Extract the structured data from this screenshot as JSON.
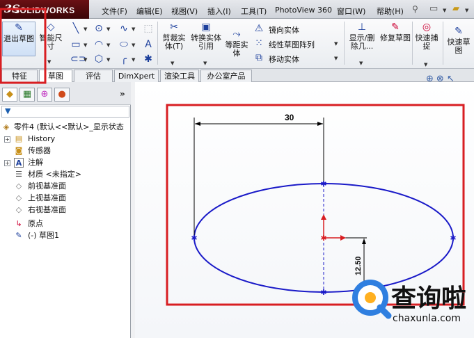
{
  "app": {
    "name": "SOLIDWORKS",
    "logo_mark": "3S"
  },
  "menu": {
    "items": [
      "文件(F)",
      "编辑(E)",
      "视图(V)",
      "插入(I)",
      "工具(T)",
      "PhotoView 360",
      "窗口(W)",
      "帮助(H)"
    ]
  },
  "ribbon": {
    "exit_sketch": "退出草图",
    "smart_dim": "智能尺寸",
    "trim": "剪裁实体(T)",
    "convert": "转换实体引用",
    "offset": "等距实体",
    "mirror": "镜向实体",
    "linear_pattern": "线性草图阵列",
    "move": "移动实体",
    "display_delete": "显示/删除几...",
    "repair": "修复草图",
    "quick_snap": "快速捕捉",
    "rapid_sketch": "快速草图"
  },
  "tabs": [
    "特征",
    "草图",
    "评估",
    "DimXpert",
    "渲染工具",
    "办公室产品"
  ],
  "tree": {
    "root": "零件4 (默认<<默认>_显示状态",
    "items": [
      "History",
      "传感器",
      "注解",
      "材质 <未指定>",
      "前视基准面",
      "上视基准面",
      "右视基准面",
      "原点",
      "(-) 草图1"
    ]
  },
  "drawing": {
    "dim_horizontal": "30",
    "dim_vertical": "12.50"
  },
  "watermark": {
    "name": "查询啦",
    "url": "chaxunla.com"
  },
  "colors": {
    "highlight_box": "#d81e22",
    "sketch": "#1a1ac8",
    "dimension": "#000000"
  }
}
